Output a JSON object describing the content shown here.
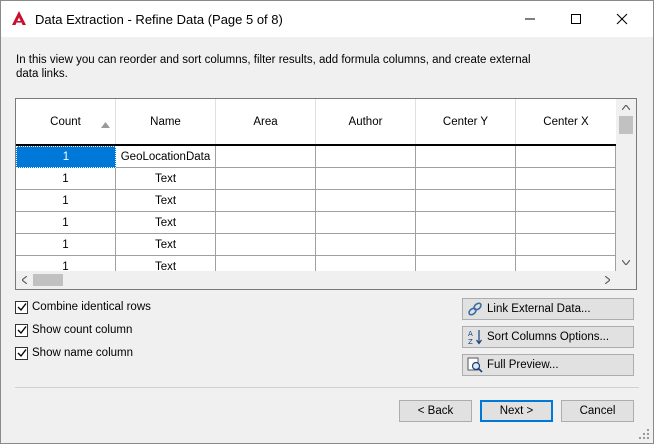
{
  "window": {
    "title": "Data Extraction - Refine Data (Page 5 of 8)",
    "app_icon": "autocad-a-icon"
  },
  "description": "In this view you can reorder and sort columns, filter results, add formula columns, and create external data links.",
  "grid": {
    "columns": [
      "Count",
      "Name",
      "Area",
      "Author",
      "Center Y",
      "Center X"
    ],
    "sorted_column": "Count",
    "sort_direction": "ascending",
    "rows": [
      {
        "count": "1",
        "name": "GeoLocationData"
      },
      {
        "count": "1",
        "name": "Text"
      },
      {
        "count": "1",
        "name": "Text"
      },
      {
        "count": "1",
        "name": "Text"
      },
      {
        "count": "1",
        "name": "Text"
      },
      {
        "count": "1",
        "name": "Text"
      }
    ],
    "selected_row": 0
  },
  "options": {
    "combine_identical_rows": {
      "label": "Combine identical rows",
      "checked": true
    },
    "show_count_column": {
      "label": "Show count column",
      "checked": true
    },
    "show_name_column": {
      "label": "Show name column",
      "checked": true
    }
  },
  "side_buttons": {
    "link_external": "Link External Data...",
    "sort_columns": "Sort Columns Options...",
    "full_preview": "Full Preview..."
  },
  "footer": {
    "back": "< Back",
    "next": "Next >",
    "cancel": "Cancel"
  },
  "colors": {
    "selection": "#0078d7",
    "app_icon_red": "#c8102e"
  }
}
